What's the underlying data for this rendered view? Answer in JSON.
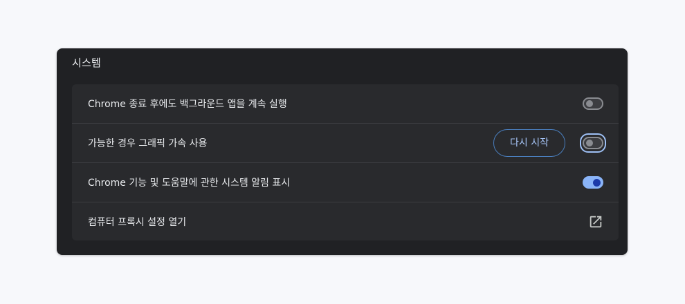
{
  "section": {
    "title": "시스템"
  },
  "rows": [
    {
      "label": "Chrome 종료 후에도 백그라운드 앱을 계속 실행",
      "toggle": "off"
    },
    {
      "label": "가능한 경우 그래픽 가속 사용",
      "toggle": "off",
      "button_label": "다시 시작"
    },
    {
      "label": "Chrome 기능 및 도움말에 관한 시스템 알림 표시",
      "toggle": "on"
    },
    {
      "label": "컴퓨터 프록시 설정 열기",
      "icon": "external-link-icon"
    }
  ],
  "colors": {
    "page_background": "#f7f8fb",
    "panel_background": "#202124",
    "card_background": "#292a2d",
    "text": "#e8eaed",
    "accent": "#8ab4f8",
    "button_text": "#a8c7fa"
  }
}
